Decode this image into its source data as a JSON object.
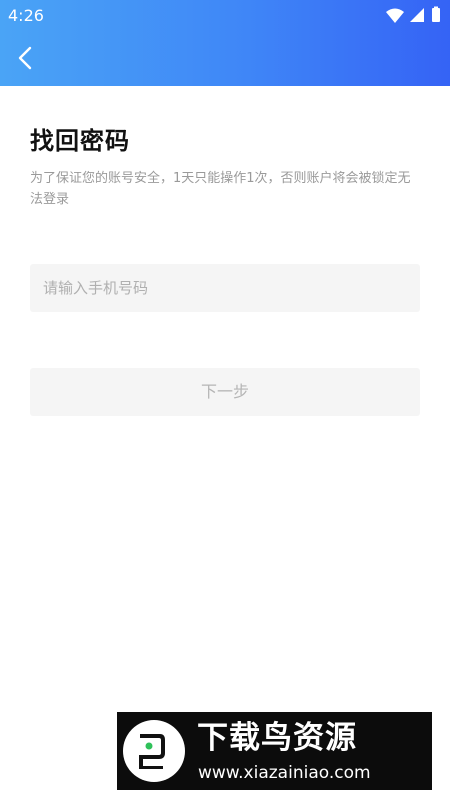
{
  "status_bar": {
    "time": "4:26",
    "icons": [
      "wifi-icon",
      "signal-icon",
      "battery-icon"
    ]
  },
  "header": {
    "back_icon": "chevron-left-icon"
  },
  "main": {
    "title": "找回密码",
    "description": "为了保证您的账号安全，1天只能操作1次，否则账户将会被锁定无法登录",
    "phone_input": {
      "value": "",
      "placeholder": "请输入手机号码"
    },
    "next_button_label": "下一步"
  },
  "watermark": {
    "title": "下载鸟资源",
    "url": "www.xiazainiao.com"
  },
  "colors": {
    "header_start": "#4aa4f6",
    "header_end": "#3563f5",
    "input_bg": "#f5f5f5",
    "disabled_text": "#b5b5b5"
  }
}
